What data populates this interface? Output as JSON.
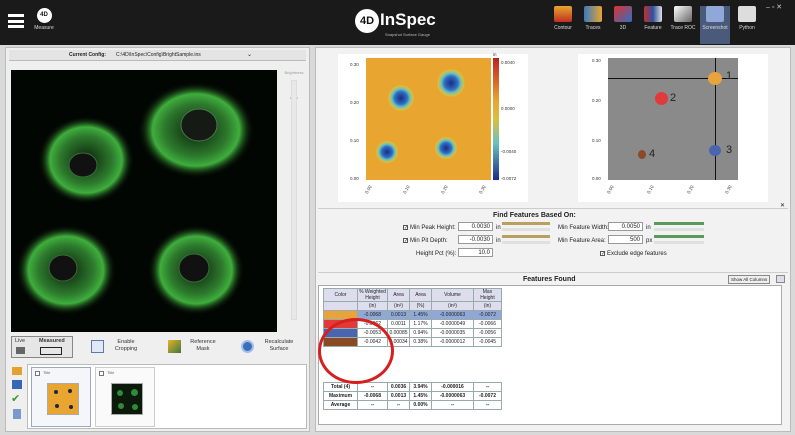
{
  "app": {
    "logo_text": "4D",
    "name": "InSpec",
    "tagline": "Snapshot Surface Gauge"
  },
  "measure": {
    "label": "Measure",
    "logo": "4D"
  },
  "toolbar": [
    {
      "label": "Contour",
      "icon": "contour-icon"
    },
    {
      "label": "Traces",
      "icon": "traces-icon"
    },
    {
      "label": "3D",
      "icon": "3d-icon"
    },
    {
      "label": "Feature",
      "icon": "feature-icon"
    },
    {
      "label": "Trace ROC",
      "icon": "trace-roc-icon"
    },
    {
      "label": "Screenshot",
      "icon": "screenshot-icon"
    },
    {
      "label": "Python",
      "icon": "python-icon"
    }
  ],
  "window_controls": {
    "minimize": "–",
    "restore": "▫",
    "close": "✕"
  },
  "config": {
    "label": "Current Config:",
    "value": "C:\\4D\\InSpec\\Config\\BrightSample.ins"
  },
  "side_slider": {
    "top_label": "Brightness",
    "sub_label": "Auto"
  },
  "capture_buttons": {
    "live": "Live",
    "measured": "Measured",
    "enable_cropping": "Enable Cropping",
    "reference_mask": "Reference Mask",
    "recalculate_surface": "Recalculate Surface"
  },
  "thumbs": [
    {
      "title": "Title"
    },
    {
      "title": "Title"
    }
  ],
  "contour_plot": {
    "y_ticks": [
      "0.30",
      "0.20",
      "0.10",
      "0.00"
    ],
    "x_ticks": [
      "0.00",
      "0.10",
      "0.20",
      "0.30"
    ],
    "unit": "in",
    "colorbar_ticks": [
      "0.0040",
      "0.0000",
      "-0.0040",
      "-0.0072"
    ]
  },
  "feature_plot": {
    "y_ticks": [
      "0.30",
      "0.20",
      "0.10",
      "0.00"
    ],
    "x_ticks": [
      "0.00",
      "0.10",
      "0.20",
      "0.30"
    ],
    "markers": [
      "1",
      "2",
      "3",
      "4"
    ]
  },
  "find_features": {
    "title": "Find Features Based On:",
    "min_peak_height_label": "Min Peak Height:",
    "min_peak_height": "0.0030",
    "min_pit_depth_label": "Min Pit Depth:",
    "min_pit_depth": "-0.0030",
    "height_pct_label": "Height Pct (%):",
    "height_pct": "10.0",
    "min_feature_width_label": "Min Feature Width:",
    "min_feature_width": "0.0050",
    "min_feature_area_label": "Min Feature Area:",
    "min_feature_area": "500",
    "exclude_edge_label": "Exclude edge features",
    "unit_in": "in",
    "unit_px": "px"
  },
  "features_found": {
    "title": "Features Found",
    "show_all_button": "Show All Columns",
    "headers": [
      "Color",
      "% Weighted Height",
      "Area",
      "Area",
      "Volume",
      "Max Height"
    ],
    "units": [
      "",
      "(in)",
      "(in²)",
      "(%)",
      "(in³)",
      "(in)"
    ],
    "rows": [
      {
        "color": "#e8a33a",
        "values": [
          "-0.0068",
          "0.0013",
          "1.45%",
          "-0.0000063",
          "-0.0072"
        ]
      },
      {
        "color": "#e03a3a",
        "values": [
          "-0.0062",
          "0.0011",
          "1.17%",
          "-0.0000049",
          "-0.0066"
        ]
      },
      {
        "color": "#4a64b0",
        "values": [
          "-0.0053",
          "0.00085",
          "0.94%",
          "-0.0000035",
          "-0.0056"
        ]
      },
      {
        "color": "#8a4a24",
        "values": [
          "-0.0042",
          "0.00034",
          "0.38%",
          "-0.0000012",
          "-0.0045"
        ]
      }
    ],
    "summary": [
      {
        "label": "Total (4)",
        "values": [
          "--",
          "0.0036",
          "3.94%",
          "-0.000016",
          "--"
        ]
      },
      {
        "label": "Maximum",
        "values": [
          "-0.0068",
          "0.0013",
          "1.45%",
          "-0.0000063",
          "-0.0072"
        ]
      },
      {
        "label": "Average",
        "values": [
          "--",
          "--",
          "0.00%",
          "--",
          "--"
        ]
      }
    ]
  },
  "colors": {
    "highlight_circle": "#d62020",
    "topbar": "#1a1a1a",
    "selected_row": "#8fa8d8"
  }
}
